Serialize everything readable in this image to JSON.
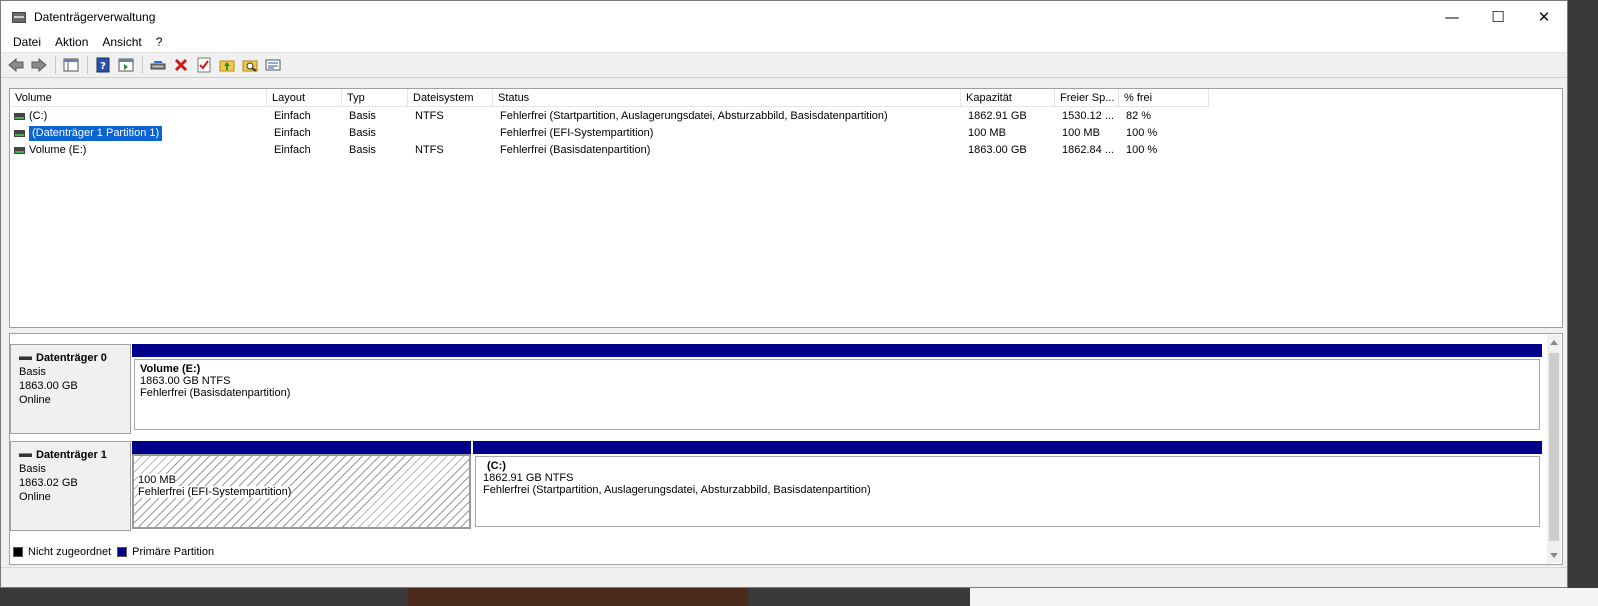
{
  "window": {
    "title": "Datenträgerverwaltung",
    "minimize": "—",
    "maximize": "☐",
    "close": "✕"
  },
  "menu": [
    "Datei",
    "Aktion",
    "Ansicht",
    "?"
  ],
  "toolbar": {
    "icons": [
      "back-arrow-icon",
      "forward-arrow-icon",
      "console-tree-icon",
      "help-icon",
      "properties-pane-icon",
      "rescan-disks-icon",
      "delete-icon",
      "check-disk-icon",
      "folder-up-icon",
      "folder-search-icon",
      "properties-icon"
    ]
  },
  "volume_list": {
    "columns": [
      "Volume",
      "Layout",
      "Typ",
      "Dateisystem",
      "Status",
      "Kapazität",
      "Freier Sp...",
      "% frei"
    ],
    "rows": [
      {
        "volume": "(C:)",
        "layout": "Einfach",
        "typ": "Basis",
        "fs": "NTFS",
        "status": "Fehlerfrei (Startpartition, Auslagerungsdatei, Absturzabbild, Basisdatenpartition)",
        "capacity": "1862.91 GB",
        "free": "1530.12 ...",
        "pct": "82 %"
      },
      {
        "volume": "(Datenträger 1 Partition 1)",
        "layout": "Einfach",
        "typ": "Basis",
        "fs": "",
        "status": "Fehlerfrei (EFI-Systempartition)",
        "capacity": "100 MB",
        "free": "100 MB",
        "pct": "100 %"
      },
      {
        "volume": "Volume (E:)",
        "layout": "Einfach",
        "typ": "Basis",
        "fs": "NTFS",
        "status": "Fehlerfrei (Basisdatenpartition)",
        "capacity": "1863.00 GB",
        "free": "1862.84 ...",
        "pct": "100 %"
      }
    ]
  },
  "disks": [
    {
      "name": "Datenträger 0",
      "type": "Basis",
      "size": "1863.00 GB",
      "state": "Online",
      "partitions": [
        {
          "title": "Volume  (E:)",
          "size": "1863.00 GB NTFS",
          "status": "Fehlerfrei (Basisdatenpartition)"
        }
      ]
    },
    {
      "name": "Datenträger 1",
      "type": "Basis",
      "size": "1863.02 GB",
      "state": "Online",
      "partitions": [
        {
          "title": "",
          "size": "100 MB",
          "status": "Fehlerfrei (EFI-Systempartition)"
        },
        {
          "title": "(C:)",
          "size": "1862.91 GB NTFS",
          "status": "Fehlerfrei (Startpartition, Auslagerungsdatei, Absturzabbild, Basisdatenpartition)"
        }
      ]
    }
  ],
  "legend": [
    {
      "label": "Nicht zugeordnet",
      "color": "#000000"
    },
    {
      "label": "Primäre Partition",
      "color": "#00008b"
    }
  ]
}
